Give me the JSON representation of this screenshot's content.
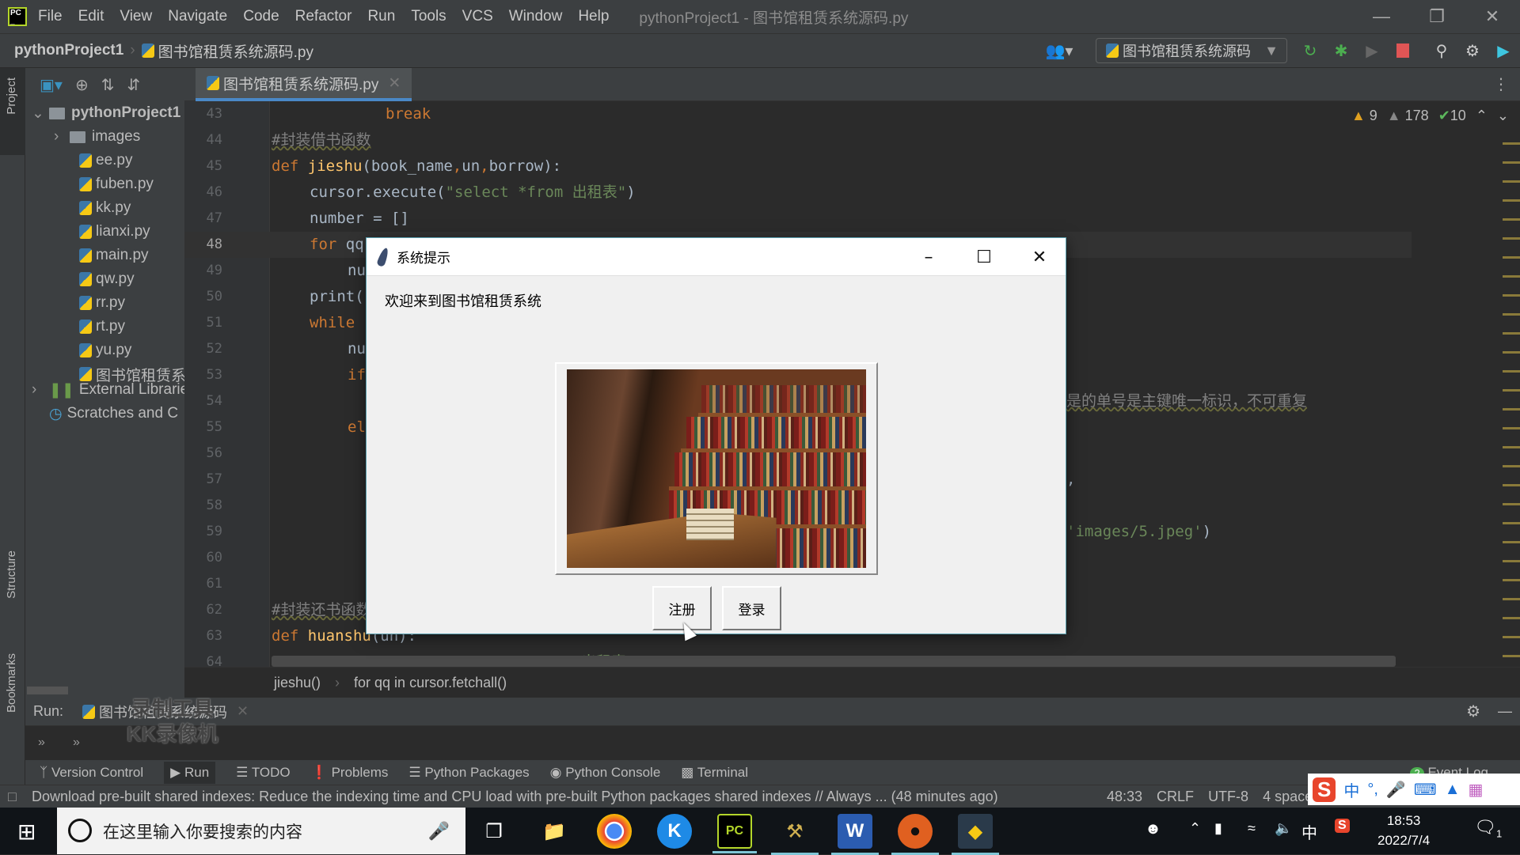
{
  "menubar": {
    "items": [
      "File",
      "Edit",
      "View",
      "Navigate",
      "Code",
      "Refactor",
      "Run",
      "Tools",
      "VCS",
      "Window",
      "Help"
    ],
    "title": "pythonProject1 - 图书馆租赁系统源码.py"
  },
  "navbar": {
    "project": "pythonProject1",
    "file": "图书馆租赁系统源码.py",
    "run_config": "图书馆租赁系统源码"
  },
  "left_strip": {
    "project": "Project",
    "structure": "Structure",
    "bookmarks": "Bookmarks"
  },
  "project_tree": {
    "root": "pythonProject1",
    "folder": "images",
    "files": [
      "ee.py",
      "fuben.py",
      "kk.py",
      "lianxi.py",
      "main.py",
      "qw.py",
      "rr.py",
      "rt.py",
      "yu.py",
      "图书馆租赁系"
    ],
    "external": "External Librarie",
    "scratches": "Scratches and C"
  },
  "editor": {
    "tab": "图书馆租赁系统源码.py",
    "inspections": {
      "warnings": "9",
      "weak_warnings": "178",
      "ok": "10"
    },
    "current_line": 48,
    "lines": [
      {
        "n": "43",
        "indent": 3,
        "tokens": [
          [
            "kw",
            "break"
          ]
        ]
      },
      {
        "n": "44",
        "indent": 0,
        "tokens": [
          [
            "cm",
            "#封装借书函数"
          ]
        ]
      },
      {
        "n": "45",
        "indent": 0,
        "tokens": [
          [
            "kw",
            "def "
          ],
          [
            "fn",
            "jieshu"
          ],
          [
            "",
            "(book_name"
          ],
          [
            "kw",
            ","
          ],
          [
            "",
            "un"
          ],
          [
            "kw",
            ","
          ],
          [
            "",
            "borrow):"
          ]
        ]
      },
      {
        "n": "46",
        "indent": 1,
        "tokens": [
          [
            "",
            "cursor.execute("
          ],
          [
            "st",
            "\"select *from 出租表\""
          ],
          [
            "",
            ")"
          ]
        ]
      },
      {
        "n": "47",
        "indent": 1,
        "tokens": [
          [
            "",
            "number = []"
          ]
        ]
      },
      {
        "n": "48",
        "indent": 1,
        "tokens": [
          [
            "kw",
            "for "
          ],
          [
            "",
            "qq"
          ]
        ]
      },
      {
        "n": "49",
        "indent": 2,
        "tokens": [
          [
            "",
            "nu"
          ]
        ]
      },
      {
        "n": "50",
        "indent": 1,
        "tokens": [
          [
            "",
            "print("
          ]
        ]
      },
      {
        "n": "51",
        "indent": 1,
        "tokens": [
          [
            "kw",
            "while"
          ]
        ]
      },
      {
        "n": "52",
        "indent": 2,
        "tokens": [
          [
            "",
            "nu"
          ]
        ]
      },
      {
        "n": "53",
        "indent": 2,
        "tokens": [
          [
            "kw",
            "if"
          ]
        ]
      },
      {
        "n": "54",
        "indent": 0,
        "tokens": [],
        "side": [
          [
            "cm",
            "是的单号是主键唯一标识，不可重复"
          ]
        ]
      },
      {
        "n": "55",
        "indent": 2,
        "tokens": [
          [
            "kw",
            "el"
          ]
        ]
      },
      {
        "n": "56",
        "indent": 0,
        "tokens": []
      },
      {
        "n": "57",
        "indent": 0,
        "tokens": [],
        "side": [
          [
            "",
            ","
          ]
        ]
      },
      {
        "n": "58",
        "indent": 0,
        "tokens": []
      },
      {
        "n": "59",
        "indent": 0,
        "tokens": [],
        "side": [
          [
            "st",
            "'images/5.jpeg'"
          ],
          [
            "",
            ")"
          ]
        ]
      },
      {
        "n": "60",
        "indent": 0,
        "tokens": []
      },
      {
        "n": "61",
        "indent": 0,
        "tokens": []
      },
      {
        "n": "62",
        "indent": 0,
        "tokens": [
          [
            "cm",
            "#封装还书函数"
          ]
        ]
      },
      {
        "n": "63",
        "indent": 0,
        "tokens": [
          [
            "kw",
            "def "
          ],
          [
            "fn",
            "huanshu"
          ],
          [
            "",
            "(un):"
          ]
        ]
      },
      {
        "n": "64",
        "indent": 1,
        "tokens": [
          [
            "",
            "cursor.execute("
          ],
          [
            "st",
            "\"select * from 出租表\""
          ],
          [
            "",
            ")"
          ]
        ]
      }
    ]
  },
  "breadcrumbs": [
    "jieshu()",
    "for qq in cursor.fetchall()"
  ],
  "run_panel": {
    "label": "Run:",
    "tab": "图书馆租赁系统源码"
  },
  "watermark": {
    "line1": "录制工具",
    "line2": "KK录像机"
  },
  "tool_windows": [
    "Version Control",
    "Run",
    "TODO",
    "Problems",
    "Python Packages",
    "Python Console",
    "Terminal"
  ],
  "event_log": {
    "label": "Event Log",
    "count": "2"
  },
  "statusbar": {
    "message": "Download pre-built shared indexes: Reduce the indexing time and CPU load with pre-built Python packages shared indexes // Always ... (48 minutes ago)",
    "position": "48:33",
    "line_sep": "CRLF",
    "encoding": "UTF-8",
    "indent": "4 spaces"
  },
  "dialog": {
    "title": "系统提示",
    "welcome": "欢迎来到图书馆租赁系统",
    "register": "注册",
    "login": "登录"
  },
  "taskbar": {
    "search_placeholder": "在这里输入你要搜索的内容",
    "time": "18:53",
    "date": "2022/7/4",
    "ime_lang": "中",
    "notifications": "1"
  }
}
